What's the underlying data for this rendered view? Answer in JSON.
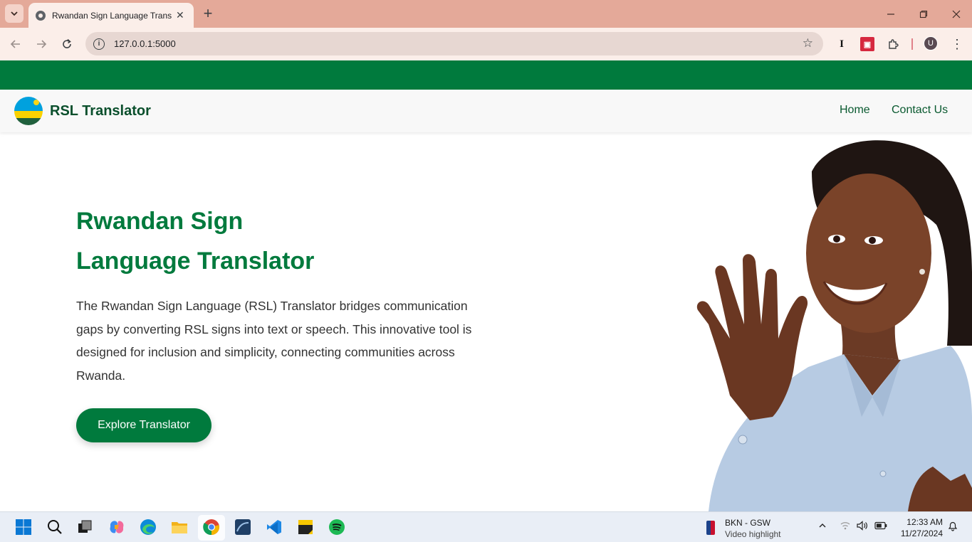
{
  "browser": {
    "tab_title": "Rwandan Sign Language Translator",
    "url": "127.0.0.1:5000",
    "profile_initial": "U",
    "extension_i_label": "I"
  },
  "site": {
    "brand": "RSL Translator",
    "nav": {
      "home": "Home",
      "contact": "Contact Us"
    },
    "hero": {
      "title_line1": "Rwandan Sign",
      "title_line2": "Language Translator",
      "description": "The Rwandan Sign Language (RSL) Translator bridges communication gaps by converting RSL signs into text or speech. This innovative tool is designed for inclusion and simplicity, connecting communities across Rwanda.",
      "cta": "Explore Translator"
    },
    "colors": {
      "primary_green": "#007a3d",
      "brand_text": "#0a4f2c",
      "flag_blue": "#00a1de",
      "flag_yellow": "#fad201",
      "flag_green": "#20603d"
    }
  },
  "taskbar": {
    "news_title": "BKN - GSW",
    "news_subtitle": "Video highlight",
    "time": "12:33 AM",
    "date": "11/27/2024",
    "apps": [
      "windows-start-icon",
      "search-icon",
      "task-view-icon",
      "copilot-icon",
      "edge-icon",
      "file-explorer-icon",
      "chrome-icon",
      "mysql-workbench-icon",
      "vscode-icon",
      "sticky-notes-icon",
      "spotify-icon"
    ]
  }
}
